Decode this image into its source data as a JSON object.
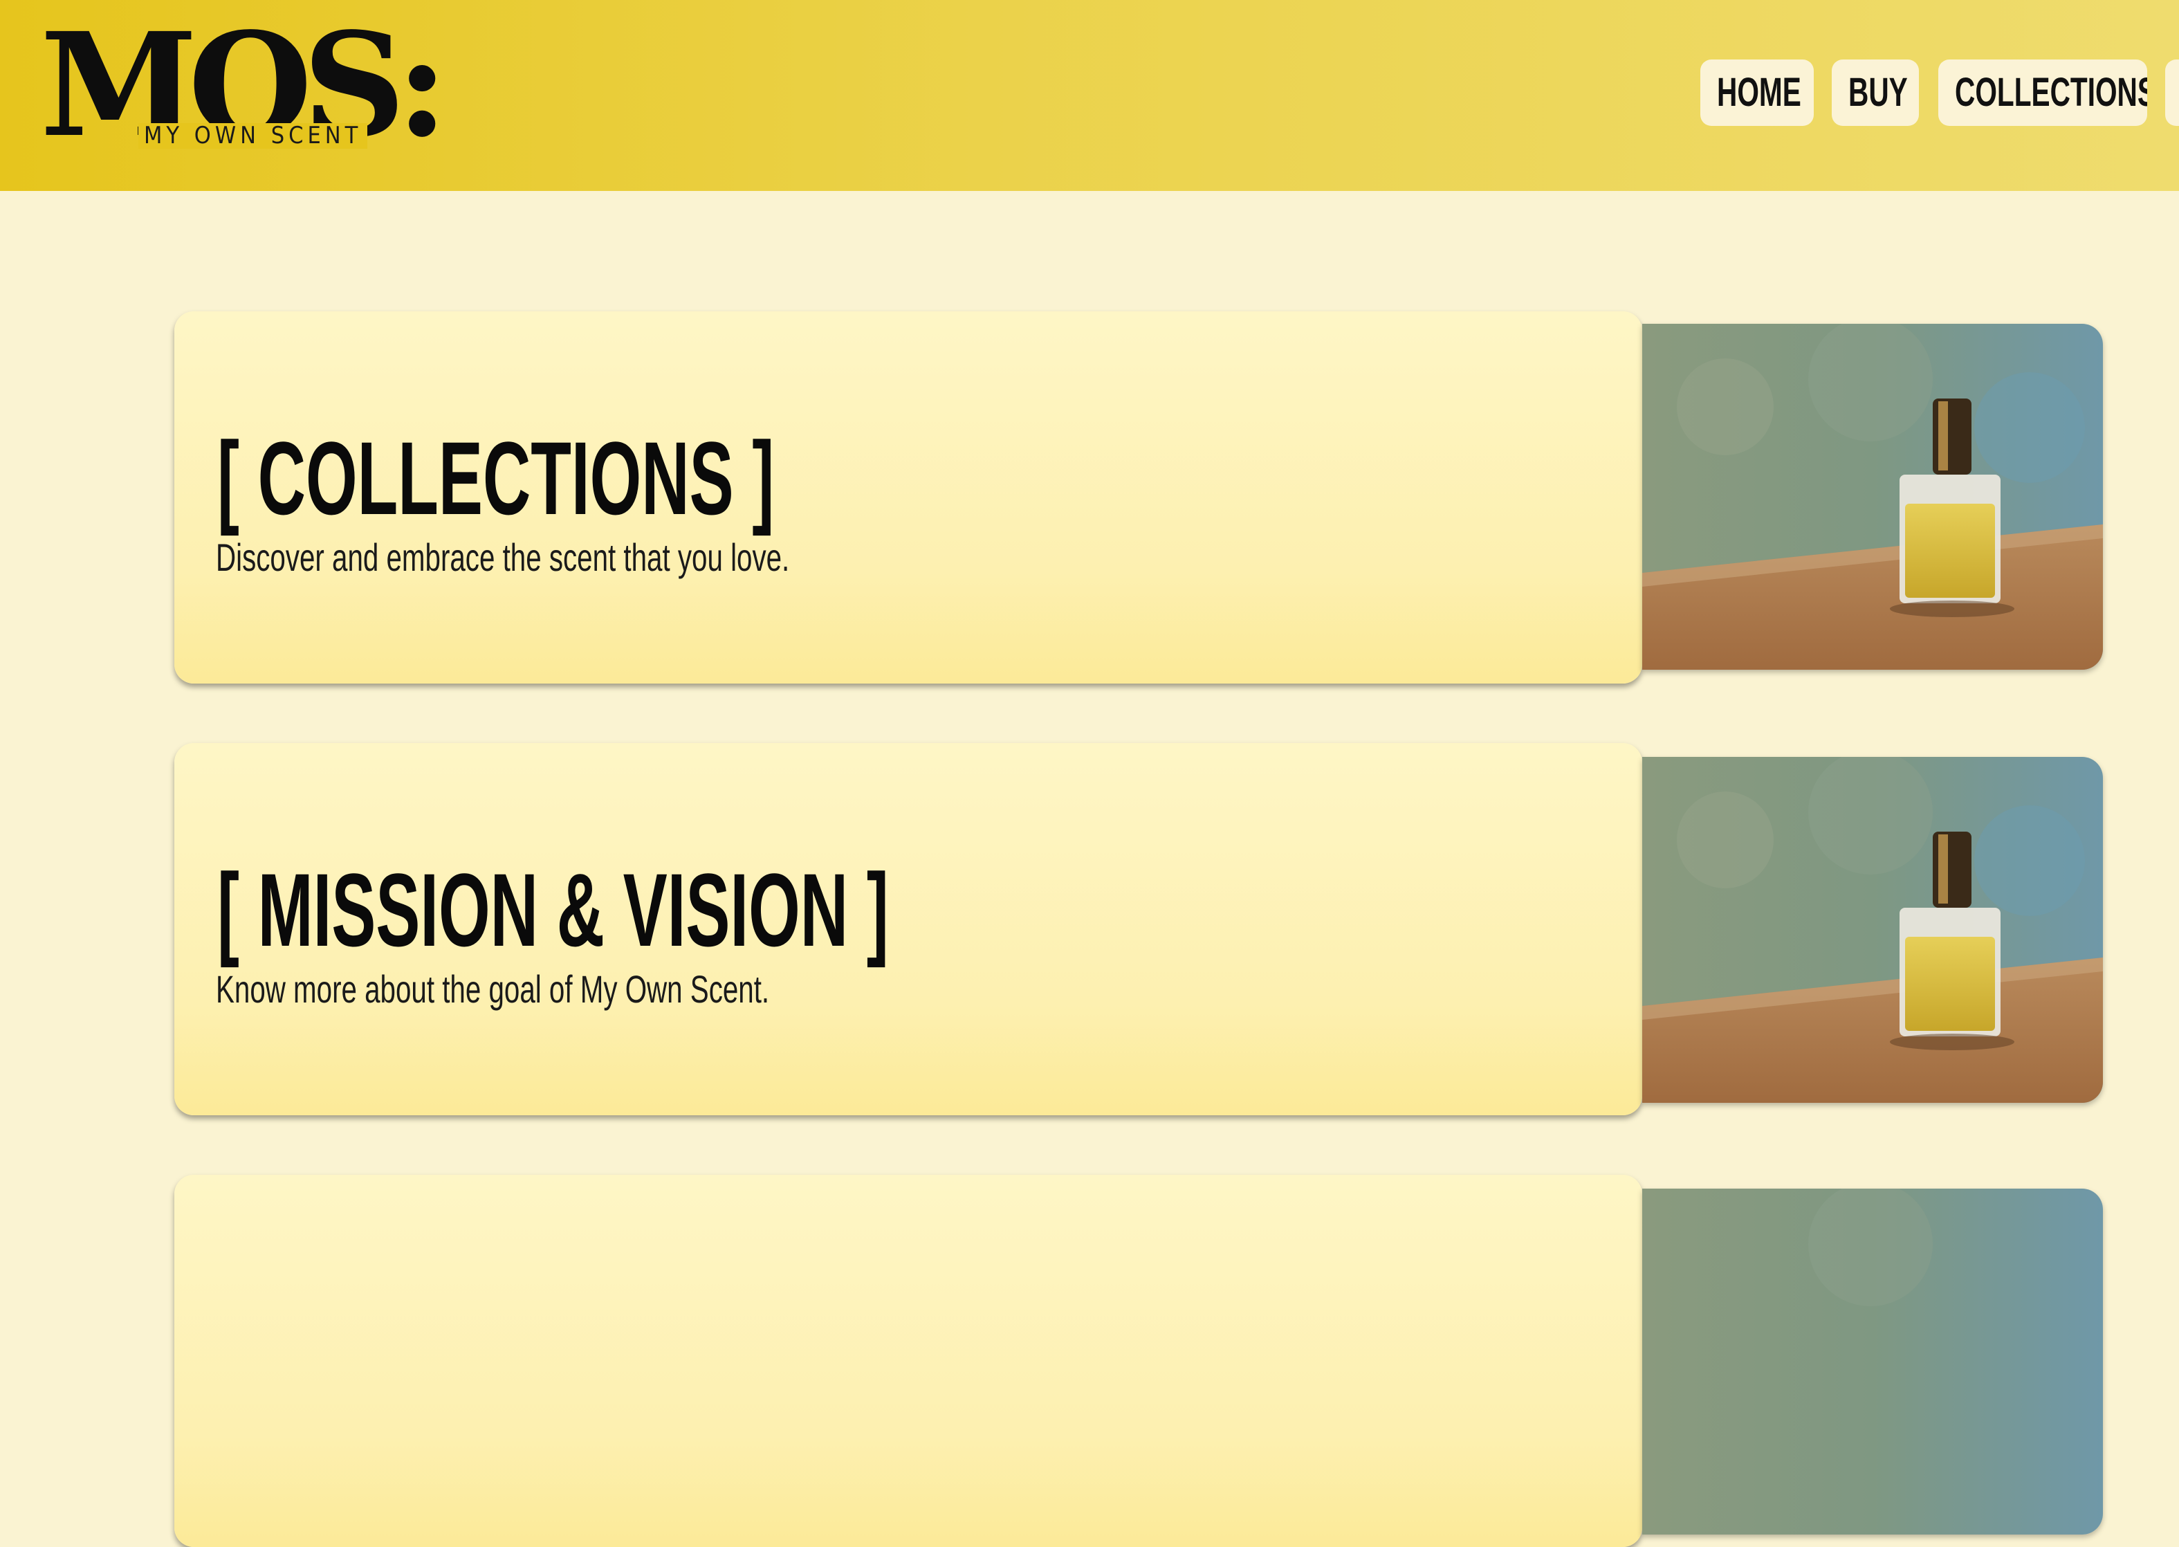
{
  "brand": {
    "logo_text": "MOS:",
    "tagline": "MY OWN SCENT"
  },
  "nav": {
    "items": [
      {
        "label": "HOME"
      },
      {
        "label": "BUY"
      },
      {
        "label": "COLLECTIONS"
      }
    ]
  },
  "cards": [
    {
      "title": "[ COLLECTIONS ]",
      "description": "Discover and embrace the scent that you love.",
      "image_alt": "perfume-bottle-photo"
    },
    {
      "title": "[ MISSION & VISION ]",
      "description": "Know more about the goal of My Own Scent.",
      "image_alt": "perfume-bottle-photo"
    }
  ],
  "colors": {
    "header_yellow": "#e6c51d",
    "page_background": "#faf3d2",
    "card_background": "#fdf0b0",
    "nav_button_background": "#fbf3d6",
    "text": "#0a0a0a"
  }
}
